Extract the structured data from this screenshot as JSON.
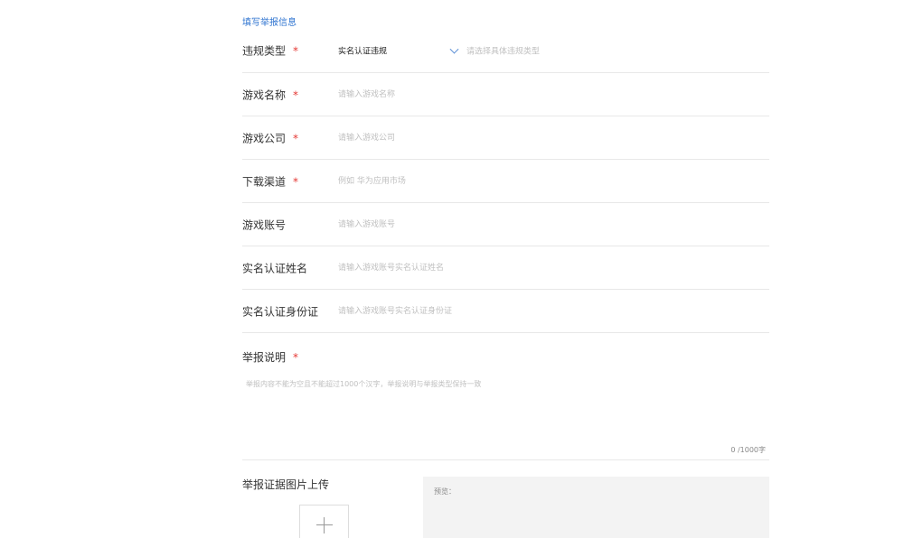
{
  "section_title": "填写举报信息",
  "violation_type": {
    "label": "违规类型",
    "required_mark": "*",
    "selected_value": "实名认证违规",
    "sub_placeholder": "请选择具体违规类型",
    "icon": "chevron-down-icon"
  },
  "fields": [
    {
      "label": "游戏名称",
      "required_mark": "*",
      "placeholder": "请输入游戏名称",
      "value": ""
    },
    {
      "label": "游戏公司",
      "required_mark": "*",
      "placeholder": "请输入游戏公司",
      "value": ""
    },
    {
      "label": "下载渠道",
      "required_mark": "*",
      "placeholder": "例如 华为应用市场",
      "value": ""
    },
    {
      "label": "游戏账号",
      "required_mark": "",
      "placeholder": "请输入游戏账号",
      "value": ""
    },
    {
      "label": "实名认证姓名",
      "required_mark": "",
      "placeholder": "请输入游戏账号实名认证姓名",
      "value": ""
    },
    {
      "label": "实名认证身份证",
      "required_mark": "",
      "placeholder": "请输入游戏账号实名认证身份证",
      "value": ""
    }
  ],
  "description": {
    "label": "举报说明",
    "required_mark": "*",
    "placeholder": "举报内容不能为空且不能超过1000个汉字，举报说明与举报类型保持一致",
    "value": "",
    "counter": "0 /1000字"
  },
  "upload": {
    "label": "举报证据图片上传",
    "icon": "plus-icon",
    "preview_label": "预览："
  },
  "colors": {
    "accent": "#2f74d0",
    "required": "#e53935",
    "placeholder": "#c0c0c0",
    "divider": "#e8e8e8",
    "preview_bg": "#f3f3f3"
  }
}
